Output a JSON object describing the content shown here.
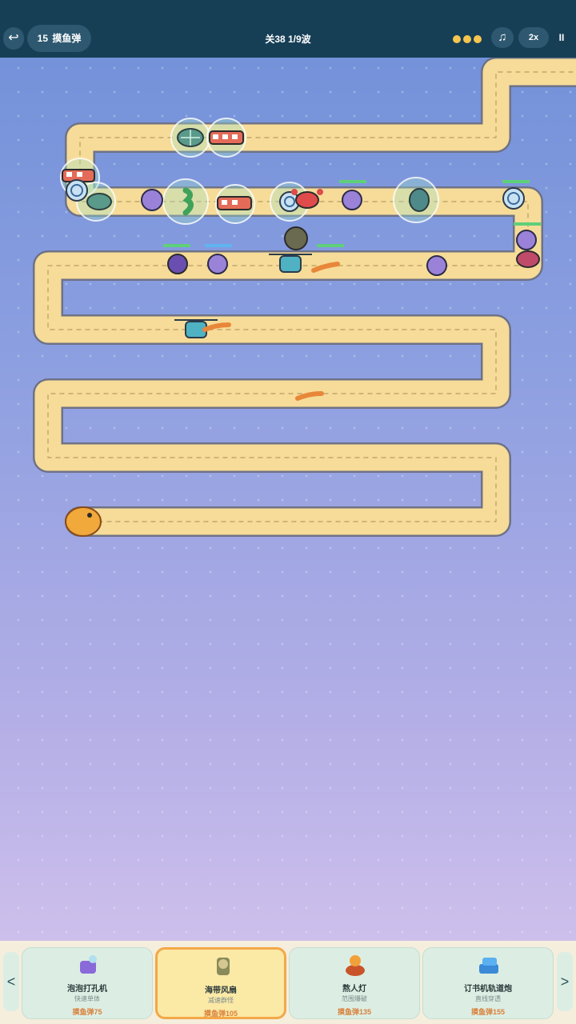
{
  "topbar": {
    "back_icon": "↩",
    "currency_amount": "15",
    "currency_label": "摸鱼弹",
    "level_label": "关38 1/9波",
    "stars_count": 3,
    "music_icon": "♫",
    "speed_label": "2x",
    "pause_icon": "II"
  },
  "tray": {
    "prev_arrow": "<",
    "next_arrow": ">",
    "towers": [
      {
        "name": "泡泡打孔机",
        "desc": "快速单体",
        "price": "摸鱼弹75",
        "selected": false
      },
      {
        "name": "海带风扇",
        "desc": "减速群怪",
        "price": "摸鱼弹105",
        "selected": true
      },
      {
        "name": "熬人灯",
        "desc": "范围爆破",
        "price": "摸鱼弹135",
        "selected": false
      },
      {
        "name": "订书机轨道炮",
        "desc": "直线穿透",
        "price": "摸鱼弹155",
        "selected": false
      }
    ]
  },
  "colors": {
    "topbar_bg": "#163f56",
    "path_fill": "#f6dc98",
    "path_border": "#6e7287",
    "accent_selected": "#f2a847",
    "price_text": "#d9803b"
  }
}
